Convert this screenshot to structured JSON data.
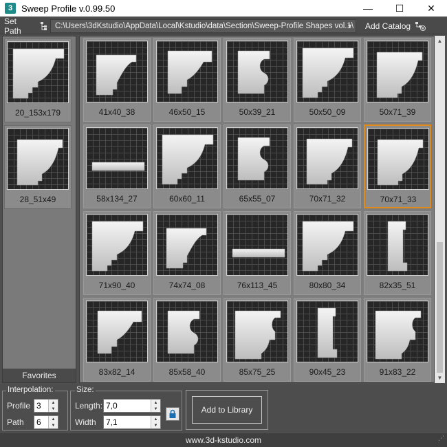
{
  "window": {
    "app_icon": "3",
    "title": "Sweep Profile v.0.99.50",
    "minimize": "—",
    "maximize": "☐",
    "close": "✕"
  },
  "toolbar": {
    "set_path": "Set Path",
    "path_value": "C:\\Users\\3dKstudio\\AppData\\Local\\Kstudio\\data\\Section\\Sweep-Profile Shapes vol.1\\",
    "add_catalog": "Add Catalog"
  },
  "favorites": {
    "items": [
      {
        "label": "20_153x179"
      },
      {
        "label": "28_51x49"
      }
    ],
    "tab_label": "Favorites"
  },
  "grid": {
    "items": [
      {
        "label": "41x40_38"
      },
      {
        "label": "46x50_15"
      },
      {
        "label": "50x39_21"
      },
      {
        "label": "50x50_09"
      },
      {
        "label": "50x71_39"
      },
      {
        "label": "58x134_27"
      },
      {
        "label": "60x60_11"
      },
      {
        "label": "65x55_07"
      },
      {
        "label": "70x71_32"
      },
      {
        "label": "70x71_33",
        "selected": true
      },
      {
        "label": "71x90_40"
      },
      {
        "label": "74x74_08"
      },
      {
        "label": "76x113_45"
      },
      {
        "label": "80x80_34"
      },
      {
        "label": "82x35_51"
      },
      {
        "label": "83x82_14"
      },
      {
        "label": "85x58_40"
      },
      {
        "label": "85x75_25"
      },
      {
        "label": "90x45_23"
      },
      {
        "label": "91x83_22"
      }
    ]
  },
  "interpolation": {
    "title": "Interpolation:",
    "profile_label": "Profile",
    "profile_value": "3",
    "path_label": "Path",
    "path_value": "6"
  },
  "size": {
    "title": "Size:",
    "length_label": "Length:",
    "length_value": "7,0",
    "width_label": "Width",
    "width_value": "7,1"
  },
  "add_to_library": "Add to Library",
  "footer": "www.3d-kstudio.com",
  "colors": {
    "selection_border": "#e08a1e",
    "panel_bg": "#4d4d4d"
  }
}
